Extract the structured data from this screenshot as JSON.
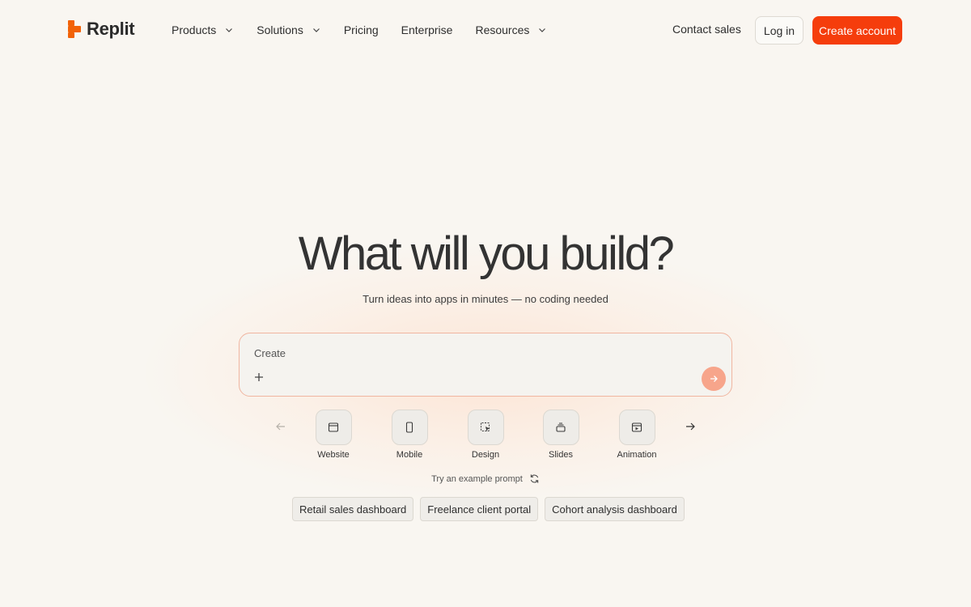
{
  "brand": {
    "name": "Replit",
    "color": "#f26207"
  },
  "nav": {
    "items": [
      {
        "label": "Products",
        "dropdown": true
      },
      {
        "label": "Solutions",
        "dropdown": true
      },
      {
        "label": "Pricing",
        "dropdown": false
      },
      {
        "label": "Enterprise",
        "dropdown": false
      },
      {
        "label": "Resources",
        "dropdown": true
      }
    ],
    "contact_sales": "Contact sales",
    "login": "Log in",
    "create_account": "Create account"
  },
  "hero": {
    "title": "What will you build?",
    "subtitle": "Turn ideas into apps in minutes — no coding needed"
  },
  "prompt": {
    "placeholder": "Create",
    "add_icon": "plus-icon",
    "send_icon": "arrow-right-icon"
  },
  "categories": [
    {
      "label": "Website",
      "icon": "browser-window-icon"
    },
    {
      "label": "Mobile",
      "icon": "phone-icon"
    },
    {
      "label": "Design",
      "icon": "design-select-icon"
    },
    {
      "label": "Slides",
      "icon": "slides-stack-icon"
    },
    {
      "label": "Animation",
      "icon": "video-frame-icon"
    }
  ],
  "examples": {
    "label": "Try an example prompt",
    "chips": [
      "Retail sales dashboard",
      "Freelance client portal",
      "Cohort analysis dashboard"
    ]
  },
  "colors": {
    "accent": "#f53d0c",
    "send_button": "#f7a58b",
    "background": "#f9f6f1"
  }
}
